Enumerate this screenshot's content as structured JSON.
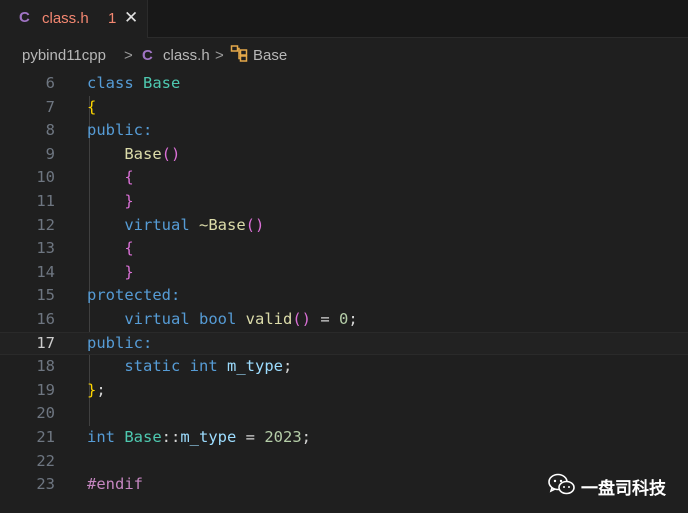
{
  "tab": {
    "icon": "c-language-icon",
    "icon_glyph": "C",
    "name": "class.h",
    "problems_count": "1",
    "close_glyph": "✕"
  },
  "breadcrumb": {
    "folder": "pybind11cpp",
    "file_icon_glyph": "C",
    "file": "class.h",
    "symbol": "Base",
    "separator": ">"
  },
  "editor": {
    "current_line": "17",
    "lines": [
      {
        "n": "6"
      },
      {
        "n": "7"
      },
      {
        "n": "8"
      },
      {
        "n": "9"
      },
      {
        "n": "10"
      },
      {
        "n": "11"
      },
      {
        "n": "12"
      },
      {
        "n": "13"
      },
      {
        "n": "14"
      },
      {
        "n": "15"
      },
      {
        "n": "16"
      },
      {
        "n": "17"
      },
      {
        "n": "18"
      },
      {
        "n": "19"
      },
      {
        "n": "20"
      },
      {
        "n": "21"
      },
      {
        "n": "22"
      },
      {
        "n": "23"
      }
    ],
    "tokens": {
      "class": "class",
      "Base": "Base",
      "public": "public",
      "protected": "protected",
      "virtual": "virtual",
      "tilde": "~",
      "bool": "bool",
      "valid": "valid",
      "static": "static",
      "int": "int",
      "m_type": "m_type",
      "scope": "::",
      "year": "2023",
      "zero": "0",
      "endif": "#endif",
      "lbrace": "{",
      "rbrace": "}",
      "lparen": "(",
      "rparen": ")",
      "parens": "()",
      "colon": ":",
      "semi": ";",
      "eq": " = "
    }
  },
  "watermark": {
    "icon": "wechat-icon",
    "text": "一盘司科技"
  },
  "colors": {
    "tab_text": "#f48771",
    "c_icon": "#a074c4",
    "keyword": "#569cd6",
    "type": "#4ec9b0",
    "function": "#dcdcaa",
    "number": "#b5cea8"
  }
}
